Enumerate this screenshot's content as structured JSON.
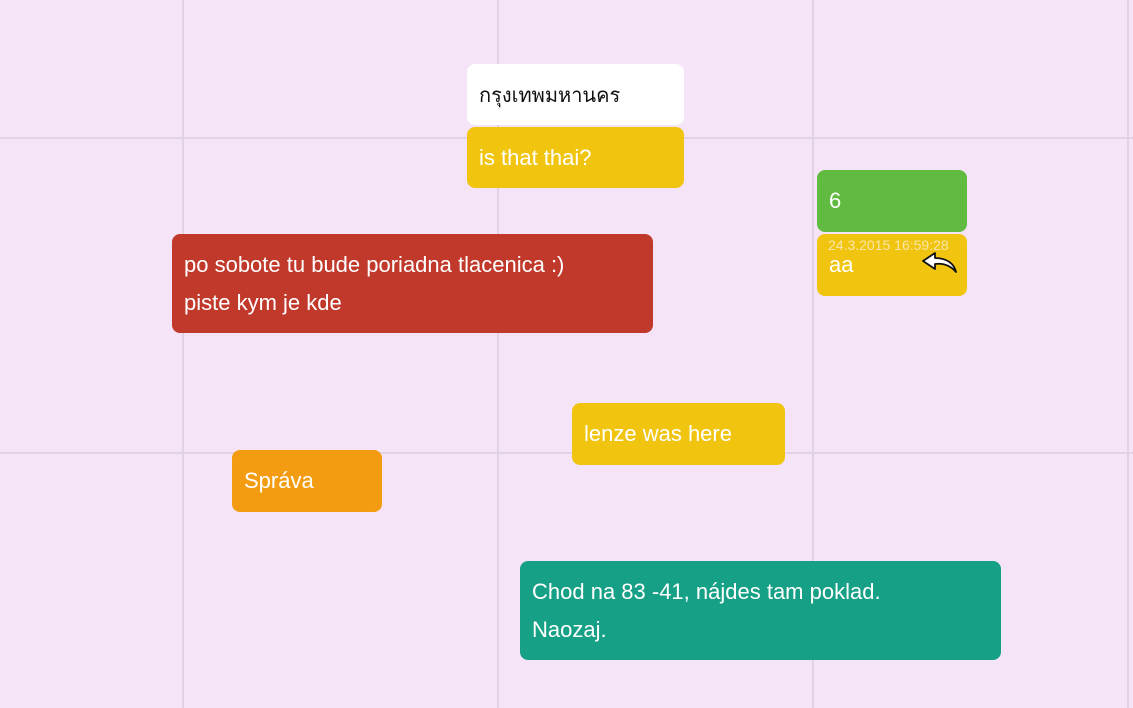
{
  "notes": {
    "thai": {
      "text": "กรุงเทพมหานคร",
      "color": "#ffffff"
    },
    "is_that": {
      "text": "is that thai?",
      "color": "#f1c40f"
    },
    "six": {
      "text": "6",
      "color": "#62bb41"
    },
    "aa": {
      "timestamp": "24.3.2015 16:59:28",
      "text": "aa",
      "icon": "reply-arrow-icon",
      "color": "#f1c40f"
    },
    "red": {
      "line1": "po sobote tu bude poriadna tlacenica :)",
      "line2": "piste kym je kde",
      "color": "#c0392b"
    },
    "lenze": {
      "text": "lenze was here",
      "color": "#f1c40f"
    },
    "sprava": {
      "text": "Správa",
      "color": "#f39c12"
    },
    "teal": {
      "line1": "Chod na 83 -41, nájdes tam poklad.",
      "line2": "Naozaj.",
      "color": "#16a085"
    }
  },
  "board": {
    "background": "#f5e4f8",
    "grid_color": "#e0d3e4"
  }
}
